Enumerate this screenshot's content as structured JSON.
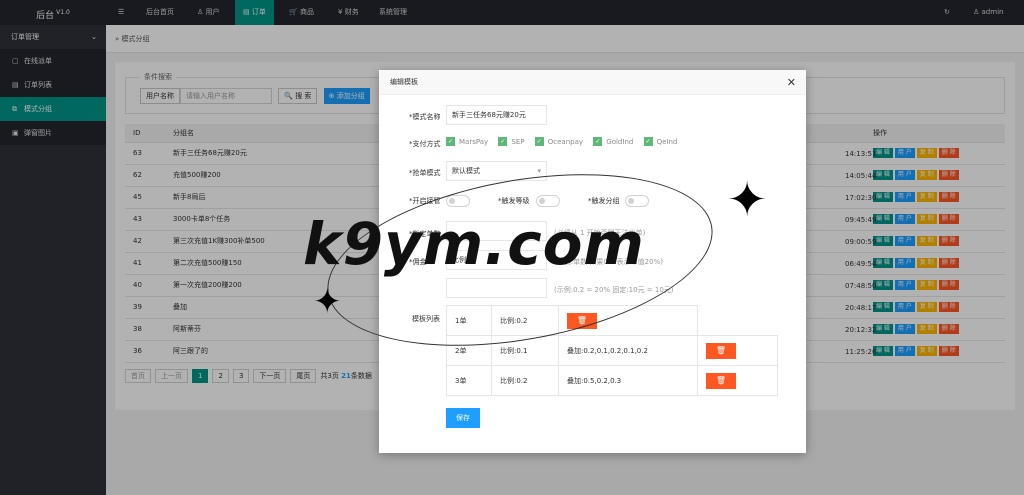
{
  "topbar": {
    "brand": "后台",
    "version": "V1.0",
    "menu_icon": "☰",
    "nav": [
      {
        "label": "后台首页",
        "icon": ""
      },
      {
        "label": "用户",
        "icon": "♙"
      },
      {
        "label": "订单",
        "icon": "▤"
      },
      {
        "label": "商品",
        "icon": "🛒"
      },
      {
        "label": "财务",
        "icon": "¥"
      },
      {
        "label": "系统管理",
        "icon": ""
      }
    ],
    "refresh_icon": "↻",
    "user": "admin",
    "user_icon": "♙"
  },
  "sidebar": {
    "group": "订单管理",
    "items": [
      {
        "label": "在线派单",
        "icon": "▢"
      },
      {
        "label": "订单列表",
        "icon": "▤"
      },
      {
        "label": "模式分组",
        "icon": "⧉"
      },
      {
        "label": "弹窗图片",
        "icon": "▣"
      }
    ]
  },
  "breadcrumb": {
    "sep": "»",
    "text": "模式分组"
  },
  "search": {
    "legend": "条件搜索",
    "label": "用户名称",
    "placeholder": "请输入用户名称",
    "search_btn": "搜 索",
    "add_btn": "添加分组"
  },
  "table": {
    "headers": [
      "ID",
      "分组名",
      "操作"
    ],
    "rows": [
      {
        "id": "63",
        "name": "新手三任务68元赚20元",
        "time": "14:13:51"
      },
      {
        "id": "62",
        "name": "充值500赚200",
        "time": "14:05:44"
      },
      {
        "id": "45",
        "name": "新手8局后",
        "time": "17:02:30"
      },
      {
        "id": "43",
        "name": "3000卡单8个任务",
        "time": "09:45:49"
      },
      {
        "id": "42",
        "name": "第三次充值1K赚300补单500",
        "time": "09:00:59"
      },
      {
        "id": "41",
        "name": "第二次充值500赚150",
        "time": "06:49:54"
      },
      {
        "id": "40",
        "name": "第一次充值200赚200",
        "time": "07:48:50"
      },
      {
        "id": "39",
        "name": "叠加",
        "time": "20:48:17"
      },
      {
        "id": "38",
        "name": "阿斯蒂芬",
        "time": "20:12:32"
      },
      {
        "id": "36",
        "name": "阿三跟了的",
        "time": "11:25:26"
      }
    ],
    "ops": {
      "edit": "编 辑",
      "user": "用 户",
      "copy": "复 制",
      "del": "删 除"
    }
  },
  "pager": {
    "first": "首页",
    "prev": "上一页",
    "pages": [
      "1",
      "2",
      "3"
    ],
    "next": "下一页",
    "last": "尾页",
    "summary_pre": "共",
    "pages_total": "3页",
    "count": "21",
    "summary_post": "条数据"
  },
  "modal": {
    "title": "编辑模板",
    "close": "✕",
    "name_label": "*模式名称",
    "name_value": "新手三任务68元赚20元",
    "pay_label": "*支付方式",
    "pay_options": [
      "MarsPay",
      "SEP",
      "Oceanpay",
      "GoldInd",
      "QeInd"
    ],
    "grab_label": "*抢单模式",
    "grab_value": "默认模式",
    "toggle1": "*开启接管",
    "toggle2": "*触发等级",
    "toggle3": "*触发分组",
    "specify_label": "*指定单数",
    "specify_hint": "(必须从 1 开始否则无法出单)",
    "reward_label": "*佣金",
    "reward_value": "比例",
    "reward_hint": "(比例:单数 如果0.2 表示单值20%)",
    "extra_hint": "(示例:0.2 = 20% 固定:10元 = 10元)",
    "tpl_label": "模板列表",
    "tpl_rows": [
      {
        "n": "1单",
        "r": "比例:0.2",
        "x": ""
      },
      {
        "n": "2单",
        "r": "比例:0.1",
        "x": "叠加:0.2,0.1,0.2,0.1,0.2"
      },
      {
        "n": "3单",
        "r": "比例:0.2",
        "x": "叠加:0.5,0.2,0.3"
      }
    ],
    "del_icon": "🗑",
    "save": "保存"
  },
  "watermark": "k9ym.com",
  "colors": {
    "primary": "#009688",
    "blue": "#1e9fff",
    "orange": "#ffb800",
    "red": "#ff5722",
    "dark": "#23262e"
  }
}
